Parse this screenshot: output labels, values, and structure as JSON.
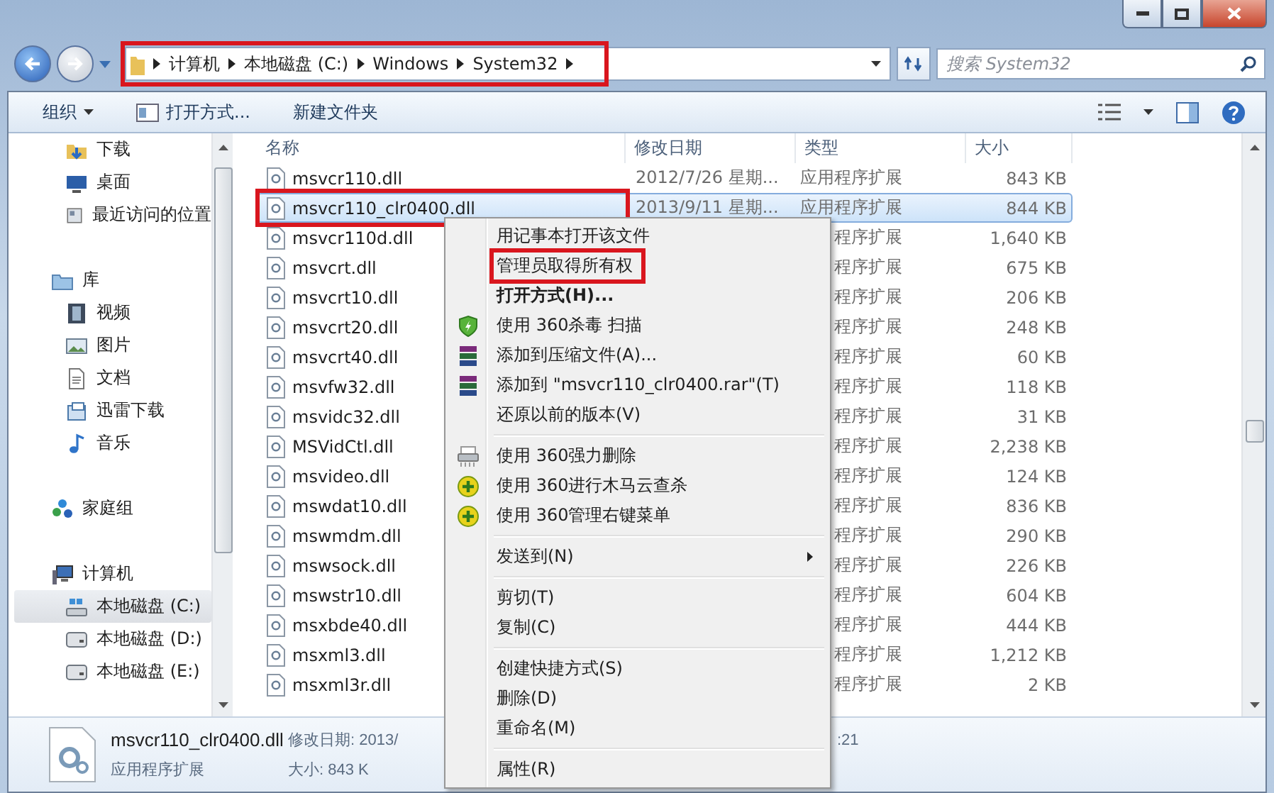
{
  "address_bar": {
    "crumbs": [
      "计算机",
      "本地磁盘 (C:)",
      "Windows",
      "System32"
    ],
    "annotated": true
  },
  "search": {
    "placeholder": "搜索 System32"
  },
  "toolbar": {
    "buttons": [
      {
        "label": "组织",
        "kind": "menu"
      },
      {
        "label": "打开方式...",
        "kind": "open"
      },
      {
        "label": "新建文件夹",
        "kind": "plain"
      }
    ]
  },
  "sidebar": {
    "sections": [
      {
        "items": [
          {
            "label": "下载",
            "kind": "download",
            "selected": false
          },
          {
            "label": "桌面",
            "kind": "desktop",
            "selected": false
          },
          {
            "label": "最近访问的位置",
            "kind": "recent",
            "selected": false
          }
        ]
      },
      {
        "label": "库",
        "kind": "library",
        "items": [
          {
            "label": "视频",
            "kind": "video",
            "selected": false
          },
          {
            "label": "图片",
            "kind": "picture",
            "selected": false
          },
          {
            "label": "文档",
            "kind": "document",
            "selected": false
          },
          {
            "label": "迅雷下载",
            "kind": "folder",
            "selected": false
          },
          {
            "label": "音乐",
            "kind": "music",
            "selected": false
          }
        ]
      },
      {
        "label": "家庭组",
        "kind": "homegroup"
      },
      {
        "label": "计算机",
        "kind": "computer",
        "items": [
          {
            "label": "本地磁盘 (C:)",
            "kind": "system-drive",
            "selected": true
          },
          {
            "label": "本地磁盘 (D:)",
            "kind": "drive",
            "selected": false
          },
          {
            "label": "本地磁盘 (E:)",
            "kind": "drive",
            "selected": false
          }
        ]
      }
    ]
  },
  "table": {
    "columns": [
      "名称",
      "修改日期",
      "类型",
      "大小"
    ],
    "rows": [
      {
        "name": "msvcr110.dll",
        "date": "2012/7/26 星期...",
        "type": "应用程序扩展",
        "size": "843 KB",
        "selected": false,
        "annotated": false
      },
      {
        "name": "msvcr110_clr0400.dll",
        "date": "2013/9/11 星期...",
        "type": "应用程序扩展",
        "size": "844 KB",
        "selected": true,
        "annotated": true
      },
      {
        "name": "msvcr110d.dll",
        "type": "程序扩展",
        "size": "1,640 KB",
        "selected": false,
        "annotated": false
      },
      {
        "name": "msvcrt.dll",
        "type": "程序扩展",
        "size": "675 KB",
        "selected": false,
        "annotated": false
      },
      {
        "name": "msvcrt10.dll",
        "type": "程序扩展",
        "size": "206 KB",
        "selected": false,
        "annotated": false
      },
      {
        "name": "msvcrt20.dll",
        "type": "程序扩展",
        "size": "248 KB",
        "selected": false,
        "annotated": false
      },
      {
        "name": "msvcrt40.dll",
        "type": "程序扩展",
        "size": "60 KB",
        "selected": false,
        "annotated": false
      },
      {
        "name": "msvfw32.dll",
        "type": "程序扩展",
        "size": "118 KB",
        "selected": false,
        "annotated": false
      },
      {
        "name": "msvidc32.dll",
        "type": "程序扩展",
        "size": "31 KB",
        "selected": false,
        "annotated": false
      },
      {
        "name": "MSVidCtl.dll",
        "type": "程序扩展",
        "size": "2,238 KB",
        "selected": false,
        "annotated": false
      },
      {
        "name": "msvideo.dll",
        "type": "程序扩展",
        "size": "124 KB",
        "selected": false,
        "annotated": false
      },
      {
        "name": "mswdat10.dll",
        "type": "程序扩展",
        "size": "836 KB",
        "selected": false,
        "annotated": false
      },
      {
        "name": "mswmdm.dll",
        "type": "程序扩展",
        "size": "290 KB",
        "selected": false,
        "annotated": false
      },
      {
        "name": "mswsock.dll",
        "type": "程序扩展",
        "size": "226 KB",
        "selected": false,
        "annotated": false
      },
      {
        "name": "mswstr10.dll",
        "type": "程序扩展",
        "size": "604 KB",
        "selected": false,
        "annotated": false
      },
      {
        "name": "msxbde40.dll",
        "type": "程序扩展",
        "size": "444 KB",
        "selected": false,
        "annotated": false
      },
      {
        "name": "msxml3.dll",
        "type": "程序扩展",
        "size": "1,212 KB",
        "selected": false,
        "annotated": false
      },
      {
        "name": "msxml3r.dll",
        "type": "程序扩展",
        "size": "2 KB",
        "selected": false,
        "annotated": false
      }
    ]
  },
  "details": {
    "name": "msvcr110_clr0400.dll",
    "date": "修改日期: 2013/",
    "date_tail": ":21",
    "type": "应用程序扩展",
    "size": "大小: 843 K"
  },
  "context_menu": {
    "items": [
      {
        "kind": "text",
        "label": "用记事本打开该文件",
        "annotated": false
      },
      {
        "kind": "text",
        "label": "管理员取得所有权",
        "annotated": true
      },
      {
        "kind": "bold",
        "label": "打开方式(H)...",
        "annotated": false
      },
      {
        "kind": "scan",
        "label": "使用 360杀毒 扫描",
        "annotated": false
      },
      {
        "kind": "archive",
        "label": "添加到压缩文件(A)...",
        "annotated": false
      },
      {
        "kind": "archive",
        "label": "添加到 \"msvcr110_clr0400.rar\"(T)",
        "annotated": false
      },
      {
        "kind": "text",
        "label": "还原以前的版本(V)",
        "annotated": false
      },
      {
        "kind": "separator"
      },
      {
        "kind": "shred",
        "label": "使用 360强力删除",
        "annotated": false
      },
      {
        "kind": "cloud",
        "label": "使用 360进行木马云查杀",
        "annotated": false
      },
      {
        "kind": "cloud",
        "label": "使用 360管理右键菜单",
        "annotated": false
      },
      {
        "kind": "separator"
      },
      {
        "kind": "submenu",
        "label": "发送到(N)",
        "annotated": false
      },
      {
        "kind": "separator"
      },
      {
        "kind": "text",
        "label": "剪切(T)",
        "annotated": false
      },
      {
        "kind": "text",
        "label": "复制(C)",
        "annotated": false
      },
      {
        "kind": "separator"
      },
      {
        "kind": "text",
        "label": "创建快捷方式(S)",
        "annotated": false
      },
      {
        "kind": "text",
        "label": "删除(D)",
        "annotated": false
      },
      {
        "kind": "text",
        "label": "重命名(M)",
        "annotated": false
      },
      {
        "kind": "separator"
      },
      {
        "kind": "text",
        "label": "属性(R)",
        "annotated": false
      }
    ]
  }
}
